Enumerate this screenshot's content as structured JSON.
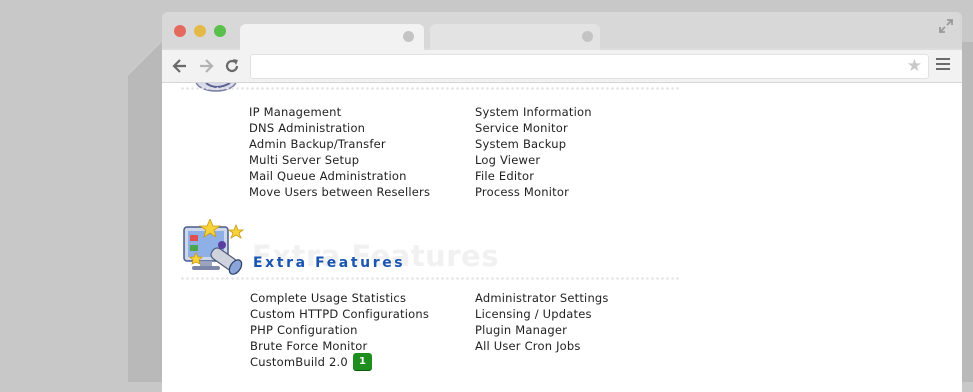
{
  "browser": {
    "tabs": [
      {
        "label": ""
      },
      {
        "label": ""
      }
    ],
    "address_bar": {
      "value": ""
    }
  },
  "admin_section": {
    "left_items": [
      "IP Management",
      "DNS Administration",
      "Admin Backup/Transfer",
      "Multi Server Setup",
      "Mail Queue Administration",
      "Move Users between Resellers"
    ],
    "right_items": [
      "System Information",
      "Service Monitor",
      "System Backup",
      "Log Viewer",
      "File Editor",
      "Process Monitor"
    ]
  },
  "extra_features": {
    "title": "Extra Features",
    "watermark": "Extra Features",
    "left_items": [
      "Complete Usage Statistics",
      "Custom HTTPD Configurations",
      "PHP Configuration",
      "Brute Force Monitor",
      "CustomBuild 2.0"
    ],
    "right_items": [
      "Administrator Settings",
      "Licensing / Updates",
      "Plugin Manager",
      "All User Cron Jobs"
    ],
    "custombuild_badge": "1"
  },
  "colors": {
    "section_title": "#1a55b0",
    "badge": "#1e8f1e"
  }
}
